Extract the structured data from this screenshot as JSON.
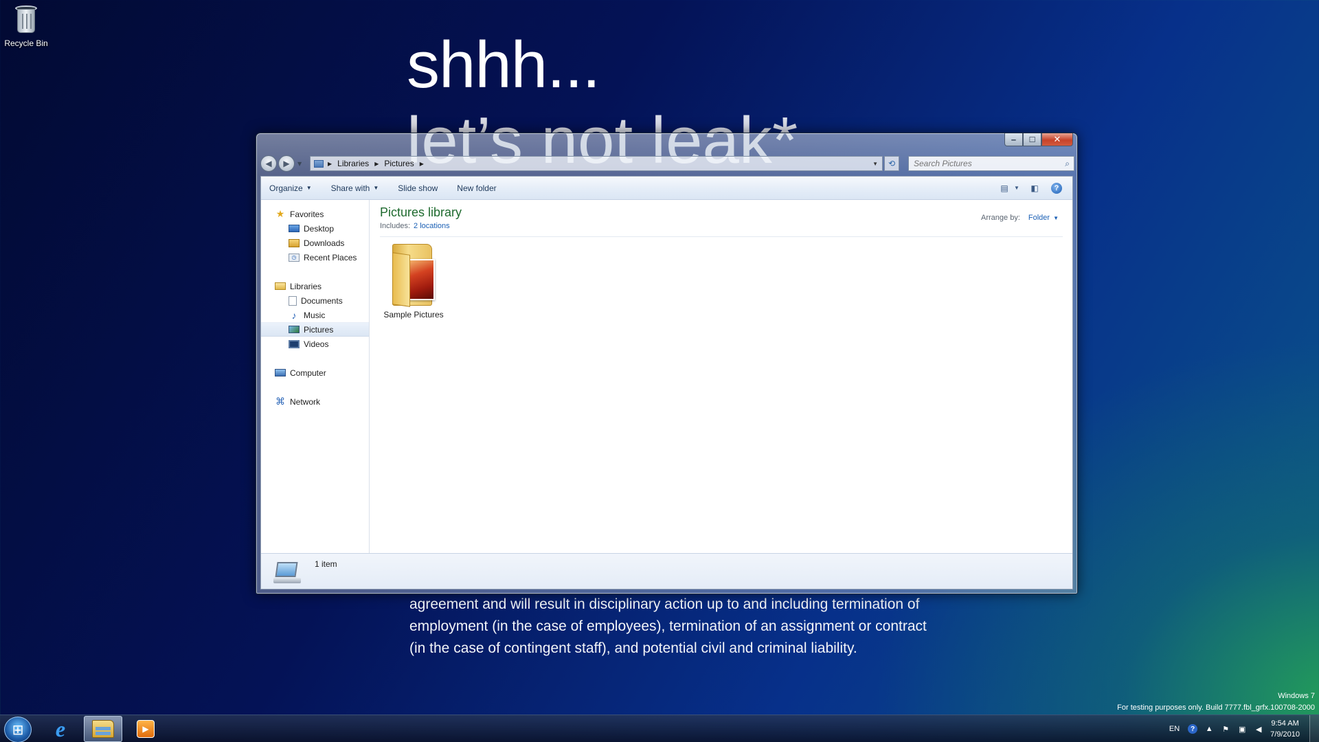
{
  "desktop": {
    "recycle_bin_label": "Recycle Bin",
    "promo_title": "shhh...",
    "promo_subtitle": "let’s not leak*",
    "legal_text": "agreement and will result in disciplinary action up to and including termination of employment (in the case of employees), termination of an assignment or contract (in the case of contingent staff), and potential civil and criminal liability.",
    "watermark_line1": "Windows 7",
    "watermark_line2": "For testing purposes only. Build 7777.fbl_grfx.100708-2000"
  },
  "window": {
    "caption_buttons": {
      "minimize": "‒",
      "maximize": "☐",
      "close": "✕"
    },
    "address": {
      "crumbs": [
        "Libraries",
        "Pictures"
      ]
    },
    "search": {
      "placeholder": "Search Pictures"
    },
    "toolbar": {
      "organize": "Organize",
      "share_with": "Share with",
      "slide_show": "Slide show",
      "new_folder": "New folder",
      "help": "?"
    },
    "nav_pane": {
      "favorites": "Favorites",
      "desktop": "Desktop",
      "downloads": "Downloads",
      "recent_places": "Recent Places",
      "libraries": "Libraries",
      "documents": "Documents",
      "music": "Music",
      "pictures": "Pictures",
      "videos": "Videos",
      "computer": "Computer",
      "network": "Network"
    },
    "library": {
      "title": "Pictures library",
      "includes_label": "Includes:",
      "includes_link": "2 locations",
      "arrange_label": "Arrange by:",
      "arrange_value": "Folder"
    },
    "files": [
      {
        "name": "Sample Pictures",
        "icon": "pictures-folder-icon"
      }
    ],
    "details": {
      "count": "1 item"
    }
  },
  "taskbar": {
    "apps": [
      "start-orb",
      "internet-explorer-icon",
      "windows-explorer-icon",
      "windows-media-player-icon"
    ],
    "tray": {
      "language": "EN",
      "time": "9:54 AM",
      "date": "7/9/2010"
    }
  },
  "colors": {
    "library_title": "#1e6a2e",
    "link": "#1a5fb4",
    "close_button": "#c7432a"
  }
}
